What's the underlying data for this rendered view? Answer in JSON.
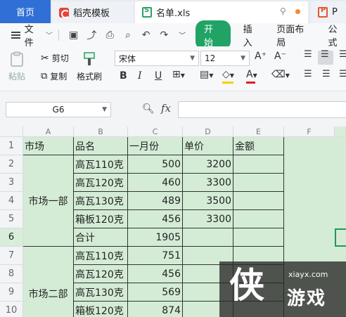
{
  "tabs": {
    "home": "首页",
    "template": "稻壳模板",
    "file": "名单.xls",
    "next": "P"
  },
  "menu": {
    "file": "文件",
    "start": "开始",
    "insert": "插入",
    "page_layout": "页面布局",
    "formula": "公式"
  },
  "ribbon": {
    "paste": "粘贴",
    "cut": "剪切",
    "copy": "复制",
    "format_painter": "格式刷",
    "font_name": "宋体",
    "font_size": "12",
    "bold": "B",
    "italic": "I",
    "underline": "U",
    "grow_font": "A⁺",
    "shrink_font": "A⁻",
    "font_color_letter": "A",
    "font_color": "#e02020",
    "fill_color": "#f2d100"
  },
  "formula_bar": {
    "name_box": "G6",
    "fx": "fx",
    "value": ""
  },
  "sheet": {
    "columns": [
      "A",
      "B",
      "C",
      "D",
      "E",
      "F"
    ],
    "rows": [
      "1",
      "2",
      "3",
      "4",
      "5",
      "6",
      "7",
      "8",
      "9",
      "10"
    ],
    "active_cell": "G6",
    "cells": {
      "A1": "市场",
      "B1": "品名",
      "C1": "一月份",
      "D1": "单价",
      "E1": "金额",
      "A2_5": "市场一部",
      "B2": "高瓦110克",
      "C2": "500",
      "D2": "3200",
      "B3": "高瓦120克",
      "C3": "460",
      "D3": "3300",
      "B4": "高瓦130克",
      "C4": "489",
      "D4": "3500",
      "B5": "箱板120克",
      "C5": "456",
      "D5": "3300",
      "B6": "合计",
      "C6": "1905",
      "A7_10": "市场二部",
      "B7": "高瓦110克",
      "C7": "751",
      "B8": "高瓦120克",
      "C8": "456",
      "B9": "高瓦130克",
      "C9": "569",
      "B10": "箱板120克",
      "C10": "874"
    }
  },
  "watermark": {
    "url": "xiayx.com",
    "name": "游戏"
  },
  "colors": {
    "accent": "#21a366",
    "home_tab": "#2f6fd6",
    "cell_fill": "#d4ecd6"
  }
}
